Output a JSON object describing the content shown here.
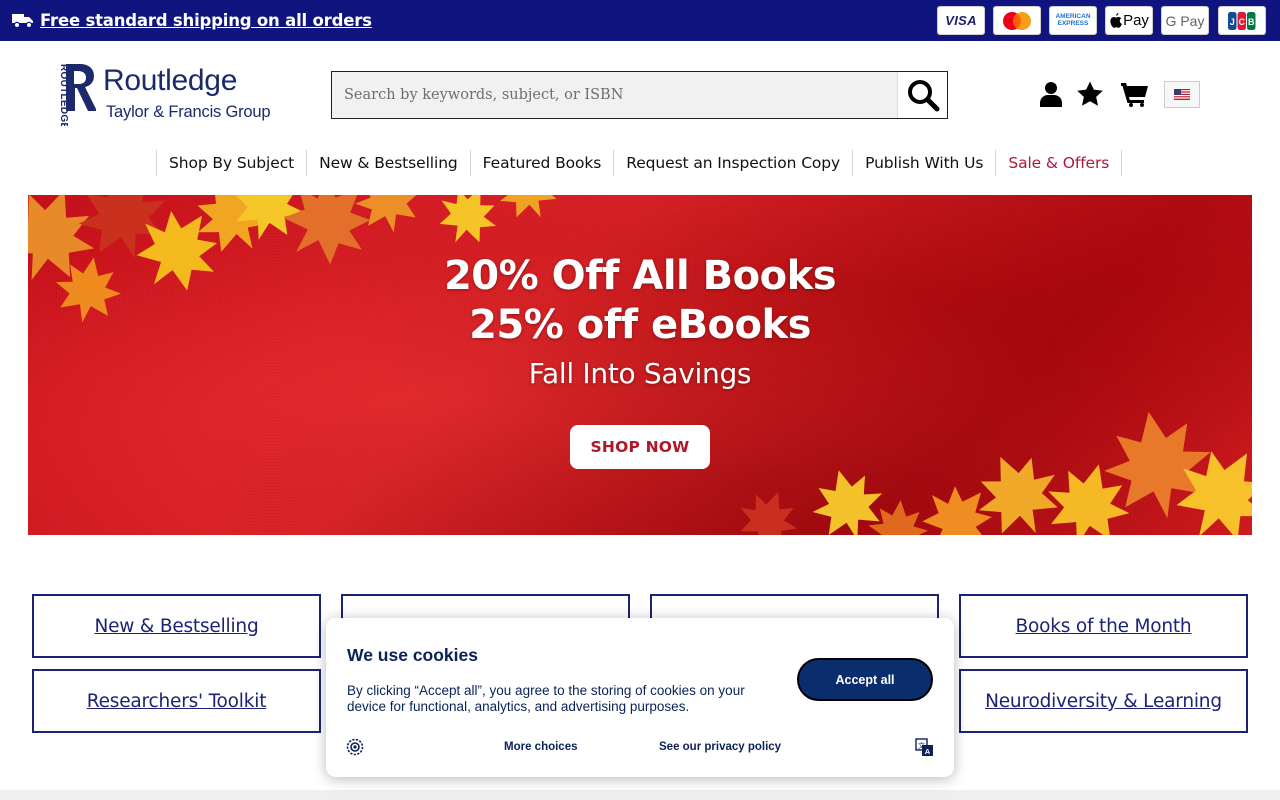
{
  "topbar": {
    "shipping_text": "Free standard shipping on all orders",
    "payment_methods": [
      "VISA",
      "Mastercard",
      "AMERICAN EXPRESS",
      "Pay",
      "G Pay",
      "JCB"
    ],
    "bg_color": "#10147e"
  },
  "header": {
    "logo_name": "Routledge",
    "logo_vertical": "ROUTLEDGE",
    "logo_sub": "Taylor & Francis Group",
    "search_placeholder": "Search by keywords, subject, or ISBN",
    "icons": [
      "user-icon",
      "star-icon",
      "cart-icon",
      "us-flag-icon"
    ]
  },
  "nav": {
    "items": [
      "Shop By Subject",
      "New & Bestselling",
      "Featured Books",
      "Request an Inspection Copy",
      "Publish With Us",
      "Sale & Offers"
    ],
    "sale_color": "#b0173b"
  },
  "hero": {
    "line1": "20% Off All Books",
    "line2": "25% off eBooks",
    "subtitle": "Fall Into Savings",
    "cta": "SHOP NOW"
  },
  "tiles": [
    "New & Bestselling",
    "Books of the Month",
    "Researchers' Toolkit",
    "Neurodiversity & Learning"
  ],
  "cookie": {
    "title": "We use cookies",
    "body": "By clicking “Accept all”, you agree to the storing of cookies on your device for functional, analytics, and advertising purposes.",
    "accept": "Accept all",
    "more_choices": "More choices",
    "privacy": "See our privacy policy"
  }
}
